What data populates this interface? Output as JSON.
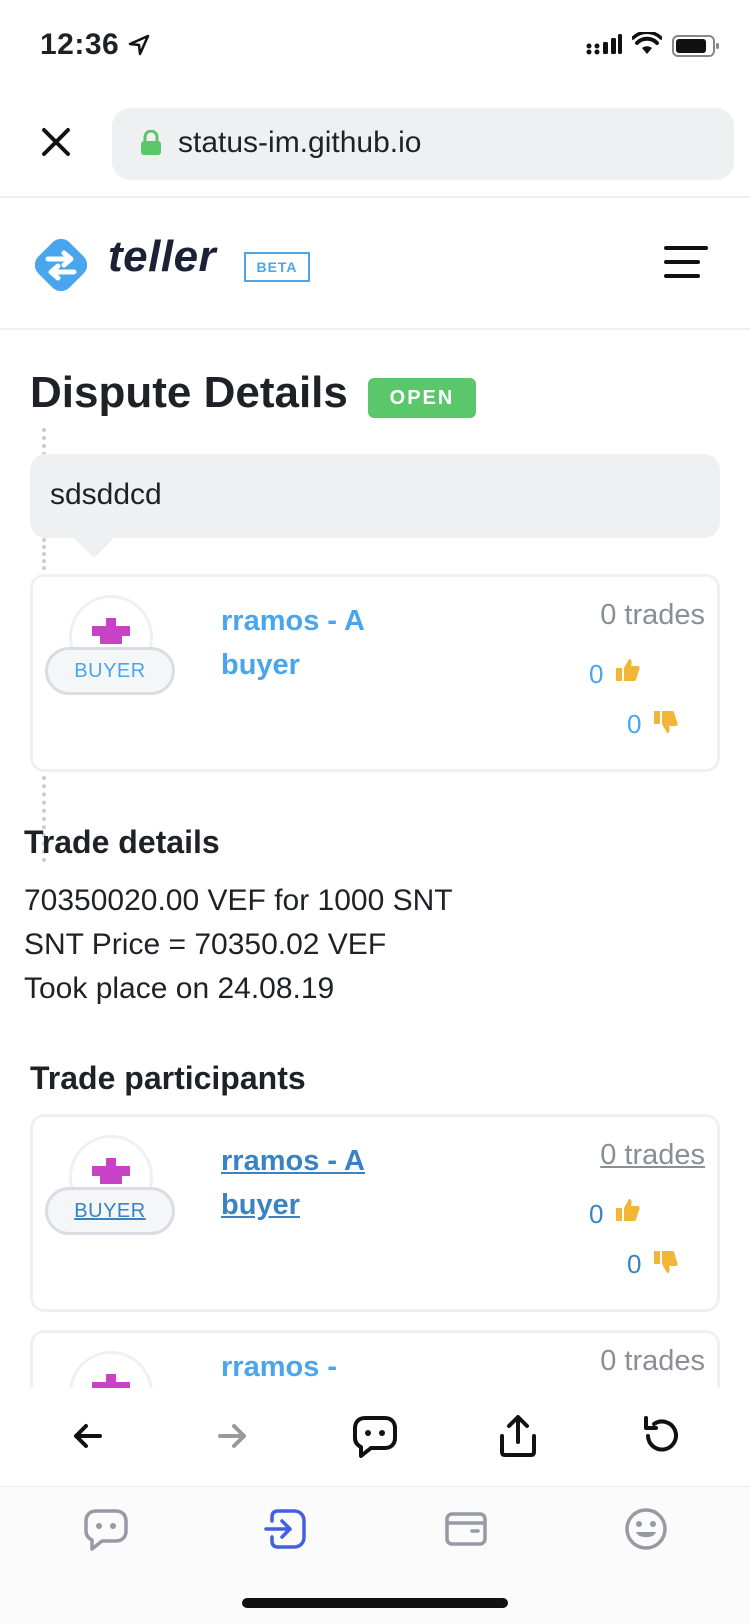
{
  "status_bar": {
    "time": "12:36"
  },
  "browser": {
    "url": "status-im.github.io"
  },
  "app_header": {
    "logo_text": "teller",
    "badge": "BETA"
  },
  "page": {
    "title": "Dispute Details",
    "status_badge": "OPEN"
  },
  "dispute_message": "sdsddcd",
  "dispute_profile": {
    "name": "rramos - A buyer",
    "role": "BUYER",
    "trades": "0 trades",
    "upvotes": "0",
    "downvotes": "0"
  },
  "trade_details": {
    "heading": "Trade details",
    "line1": "70350020.00 VEF for 1000 SNT",
    "line2": "SNT Price = 70350.02 VEF",
    "line3": "Took place on 24.08.19"
  },
  "participants": {
    "heading": "Trade participants",
    "items": [
      {
        "name": "rramos - A buyer",
        "role": "BUYER",
        "trades": "0 trades",
        "upvotes": "0",
        "downvotes": "0"
      },
      {
        "name": "rramos -",
        "trades": "0 trades"
      }
    ]
  },
  "colors": {
    "accent": "#4aa6ec",
    "open_badge": "#5ac86a",
    "avatar_identicon": "#c842c8",
    "thumbs": "#f2b535",
    "active_tab": "#4360df"
  },
  "icons": {
    "browser_toolbar": [
      "back-arrow-icon",
      "forward-arrow-icon",
      "chat-icon",
      "share-icon",
      "reload-icon"
    ],
    "tabs": [
      "chats-icon",
      "browser-icon",
      "wallet-icon",
      "profile-icon"
    ]
  }
}
